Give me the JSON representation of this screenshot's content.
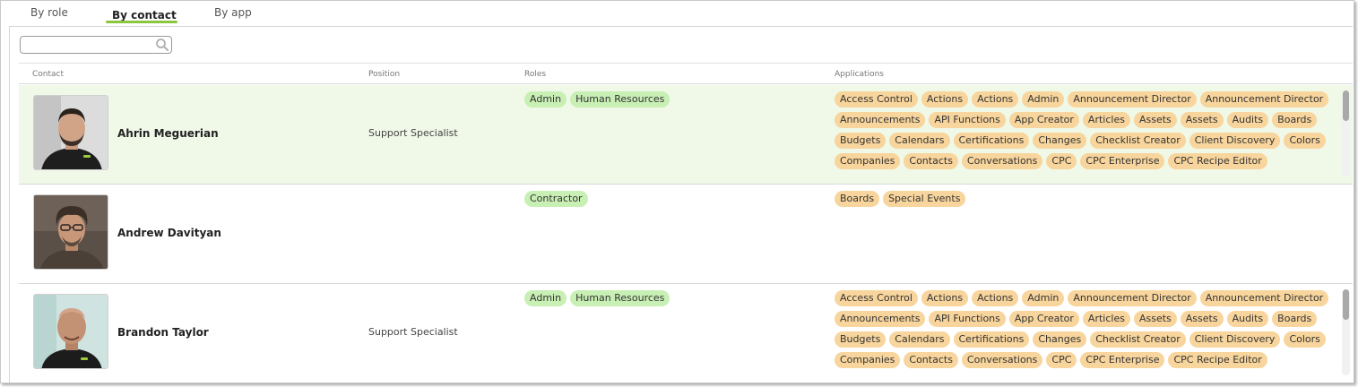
{
  "tabs": [
    {
      "label": "By role"
    },
    {
      "label": "By contact"
    },
    {
      "label": "By app"
    }
  ],
  "search": {
    "placeholder": "",
    "value": ""
  },
  "table": {
    "headers": {
      "contact": "Contact",
      "position": "Position",
      "roles": "Roles",
      "applications": "Applications"
    }
  },
  "rows": [
    {
      "name": "Ahrin Meguerian",
      "position": "Support Specialist",
      "roles": [
        "Admin",
        "Human Resources"
      ],
      "applications": [
        "Access Control",
        "Actions",
        "Actions",
        "Admin",
        "Announcement Director",
        "Announcement Director",
        "Announcements",
        "API Functions",
        "App Creator",
        "Articles",
        "Assets",
        "Assets",
        "Audits",
        "Boards",
        "Budgets",
        "Calendars",
        "Certifications",
        "Changes",
        "Checklist Creator",
        "Client Discovery",
        "Colors",
        "Companies",
        "Contacts",
        "Conversations",
        "CPC",
        "CPC Enterprise",
        "CPC Recipe Editor"
      ]
    },
    {
      "name": "Andrew Davityan",
      "position": "",
      "roles": [
        "Contractor"
      ],
      "applications": [
        "Boards",
        "Special Events"
      ]
    },
    {
      "name": "Brandon Taylor",
      "position": "Support Specialist",
      "roles": [
        "Admin",
        "Human Resources"
      ],
      "applications": [
        "Access Control",
        "Actions",
        "Actions",
        "Admin",
        "Announcement Director",
        "Announcement Director",
        "Announcements",
        "API Functions",
        "App Creator",
        "Articles",
        "Assets",
        "Assets",
        "Audits",
        "Boards",
        "Budgets",
        "Calendars",
        "Certifications",
        "Changes",
        "Checklist Creator",
        "Client Discovery",
        "Colors",
        "Companies",
        "Contacts",
        "Conversations",
        "CPC",
        "CPC Enterprise",
        "CPC Recipe Editor"
      ]
    }
  ],
  "colors": {
    "accent": "#8cc63f",
    "role_pill": "#c8efb4",
    "app_pill": "#f8d59c",
    "row_highlight": "#f0f8e8"
  },
  "icons": {
    "search": "search-icon",
    "avatar": "person-photo"
  }
}
